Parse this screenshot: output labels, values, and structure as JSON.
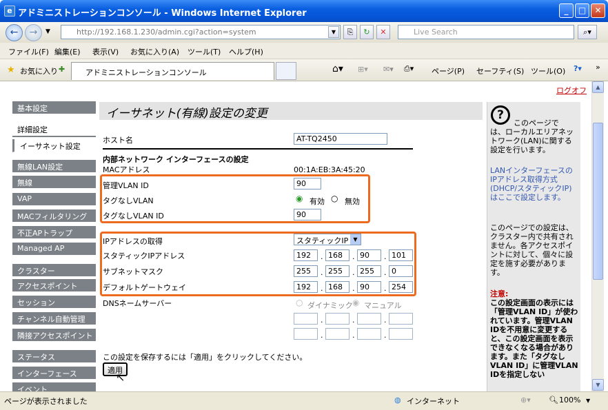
{
  "window": {
    "title": "アドミニストレーションコンソール - Windows Internet Explorer"
  },
  "navbar": {
    "address": "http://192.168.1.230/admin.cgi?action=system",
    "search_placeholder": "Live Search"
  },
  "menu": [
    "ファイル(F)",
    "編集(E)",
    "表示(V)",
    "お気に入り(A)",
    "ツール(T)",
    "ヘルプ(H)"
  ],
  "favbar": {
    "favorites": "お気に入り",
    "tab_title": "アドミニストレーションコンソール",
    "page": "ページ(P)",
    "safety": "セーフティ(S)",
    "tools": "ツール(O)"
  },
  "logout": "ログオフ",
  "sidebar": {
    "items": [
      {
        "label": "基本設定"
      },
      {
        "label": "詳細設定"
      },
      {
        "label": "イーサネット設定"
      },
      {
        "label": "無線LAN設定"
      },
      {
        "label": "無線"
      },
      {
        "label": "VAP"
      },
      {
        "label": "MACフィルタリング"
      },
      {
        "label": "不正APトラップ"
      },
      {
        "label": "Managed AP"
      },
      {
        "label": "クラスター"
      },
      {
        "label": "アクセスポイント"
      },
      {
        "label": "セッション"
      },
      {
        "label": "チャンネル自動管理"
      },
      {
        "label": "隣接アクセスポイント"
      },
      {
        "label": "ステータス"
      },
      {
        "label": "インターフェース"
      },
      {
        "label": "イベント"
      }
    ]
  },
  "page": {
    "heading": "イーサネット(有線)設定の変更",
    "hostname_label": "ホスト名",
    "hostname_value": "AT-TQ2450",
    "internal_section": "内部ネットワーク インターフェースの設定",
    "mac_label": "MACアドレス",
    "mac_value": "00:1A:EB:3A:45:20",
    "mgmt_vlan_label": "管理VLAN ID",
    "mgmt_vlan_value": "90",
    "untagged_label": "タグなしVLAN",
    "enabled": "有効",
    "disabled": "無効",
    "untagged_id_label": "タグなしVLAN ID",
    "untagged_id_value": "90",
    "ip_mode_label": "IPアドレスの取得",
    "ip_mode_value": "スタティックIP",
    "static_ip_label": "スタティックIPアドレス",
    "static_ip": [
      "192",
      "168",
      "90",
      "101"
    ],
    "subnet_label": "サブネットマスク",
    "subnet": [
      "255",
      "255",
      "255",
      "0"
    ],
    "gateway_label": "デフォルトゲートウェイ",
    "gateway": [
      "192",
      "168",
      "90",
      "254"
    ],
    "dns_label": "DNSネームサーバー",
    "dns_dynamic": "ダイナミック",
    "dns_manual": "マニュアル",
    "save_note": "この設定を保存するには「適用」をクリックしてください。",
    "apply": "適用"
  },
  "help": {
    "intro_a": "このページで",
    "intro_b": "は、ローカルエリアネットワーク(LAN)に関する設定を行います。",
    "p2": "LANインターフェースのIPアドレス取得方式(DHCP/スタティックIP)はここで設定します。",
    "p3": "このページでの設定は、クラスター内で共有されません。各アクセスポイントに対して、個々に設定を施す必要があります。",
    "caution_title": "注意:",
    "caution_body": "この設定画面の表示には「管理VLAN ID」が使われています。管理VLAN IDを不用意に変更すると、この設定画面を表示できなくなる場合があります。また「タグなしVLAN ID」に管理VLAN IDを指定しない"
  },
  "status": {
    "text": "ページが表示されました",
    "zone": "インターネット",
    "zoom": "100%"
  },
  "colors": {
    "highlight": "#ec6b21",
    "sidebar": "#7b8186",
    "titlebar": "#0553d6"
  }
}
